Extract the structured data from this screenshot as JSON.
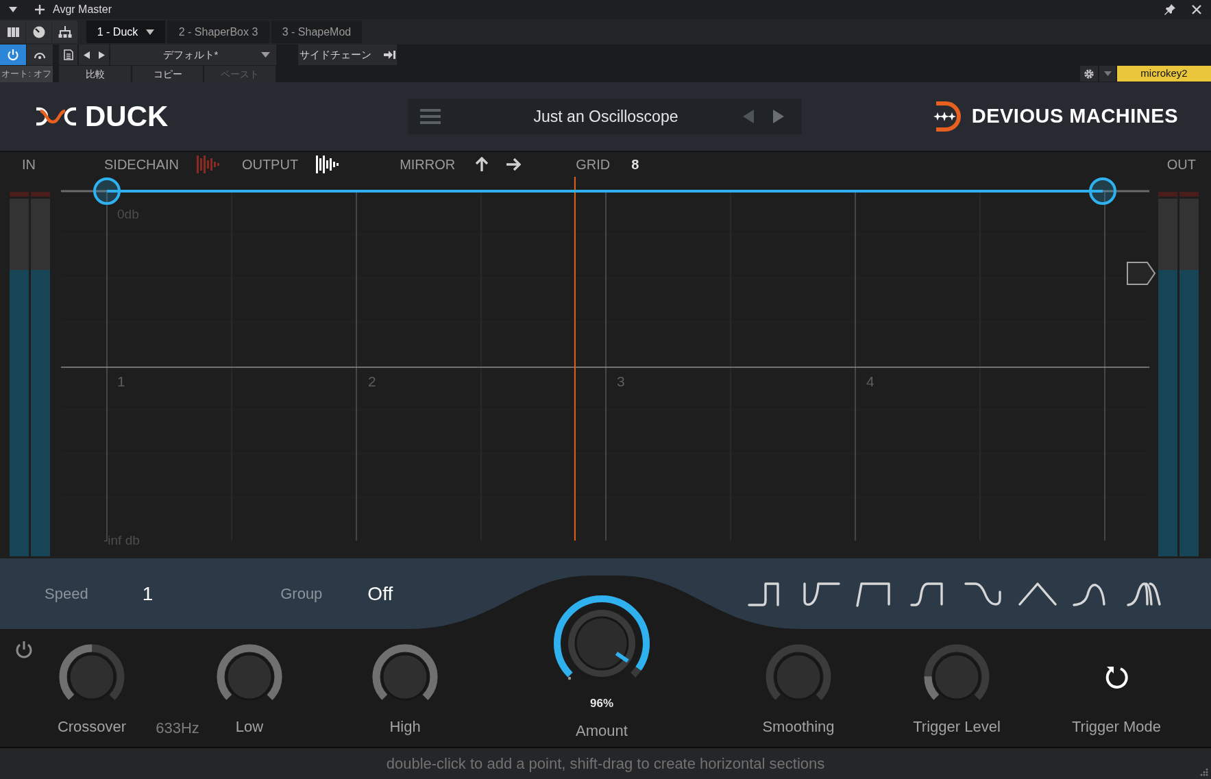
{
  "host": {
    "title": "Avgr Master",
    "plugin_tabs": [
      {
        "label": "1 - Duck",
        "selected": true
      },
      {
        "label": "2 - ShaperBox 3",
        "selected": false
      },
      {
        "label": "3 - ShapeMod",
        "selected": false
      }
    ],
    "power_on": true,
    "preset": "デフォルト*",
    "sidechain_button": "サイドチェーン",
    "auto_button": "オート: オフ",
    "buttons": [
      {
        "label": "比較",
        "disabled": false
      },
      {
        "label": "コピー",
        "disabled": false
      },
      {
        "label": "ペースト",
        "disabled": true
      }
    ],
    "device": "microkey2"
  },
  "plugin": {
    "logo": "DUCK",
    "preset_name": "Just an Oscilloscope",
    "brand": "DEVIOUS MACHINES"
  },
  "toolbar": {
    "in_label": "IN",
    "sidechain": {
      "label": "SIDECHAIN",
      "on": false
    },
    "output": {
      "label": "OUTPUT",
      "on": true
    },
    "mirror_label": "MIRROR",
    "grid_label": "GRID",
    "grid_value": "8",
    "out_label": "OUT"
  },
  "meters": {
    "in": [
      {
        "level": 0.8
      },
      {
        "level": 0.8
      }
    ],
    "out": [
      {
        "level": 0.8
      },
      {
        "level": 0.8
      }
    ]
  },
  "envelope": {
    "top_label": "0db",
    "bottom_label": "-inf db",
    "beats": [
      "1",
      "2",
      "3",
      "4"
    ],
    "playhead": {
      "level": 0.47
    }
  },
  "settings": {
    "speed_label": "Speed",
    "speed_value": "1",
    "group_label": "Group",
    "group_value": "Off"
  },
  "controls": [
    {
      "kind": "knob",
      "label": "Crossover",
      "level": 0.5
    },
    {
      "kind": "readout",
      "text": "633Hz"
    },
    {
      "kind": "knob",
      "label": "Low",
      "level": 1
    },
    {
      "kind": "knob",
      "label": "High",
      "level": 1
    },
    {
      "kind": "accent_knob",
      "label": "Amount",
      "reading": "96%",
      "level": 0.96
    },
    {
      "kind": "knob",
      "label": "Smoothing",
      "level": 0
    },
    {
      "kind": "knob",
      "label": "Trigger Level",
      "level": 0.17
    },
    {
      "kind": "mode_button",
      "label": "Trigger Mode"
    }
  ],
  "status_bar": "double-click to add a point, shift-drag to create horizontal sections"
}
